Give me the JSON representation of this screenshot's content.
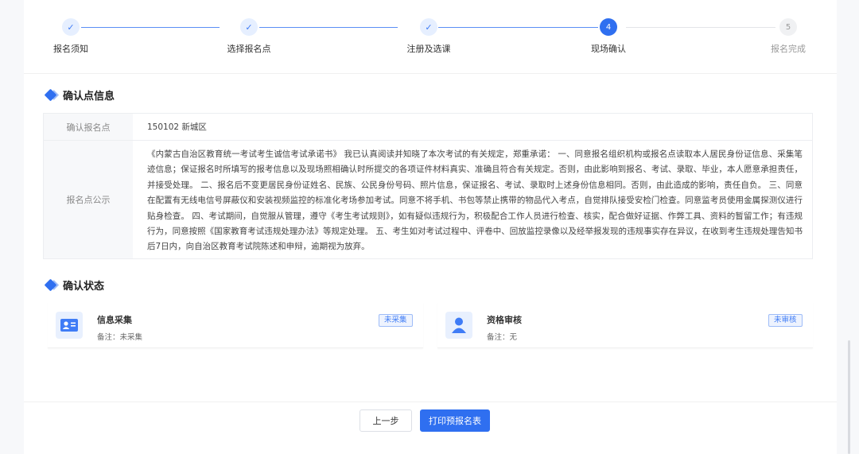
{
  "steps": [
    {
      "label": "报名须知",
      "state": "done",
      "mark": "✓"
    },
    {
      "label": "选择报名点",
      "state": "done",
      "mark": "✓"
    },
    {
      "label": "注册及选课",
      "state": "done",
      "mark": "✓"
    },
    {
      "label": "现场确认",
      "state": "active",
      "mark": "4"
    },
    {
      "label": "报名完成",
      "state": "todo",
      "mark": "5"
    }
  ],
  "confirm_info": {
    "title": "确认点信息",
    "site_label": "确认报名点",
    "site_value": "150102 新城区",
    "notice_label": "报名点公示",
    "notice_text": "《内蒙古自治区教育统一考试考生诚信考试承诺书》 我已认真阅读并知晓了本次考试的有关规定，郑重承诺： 一、同意报名组织机构或报名点读取本人居民身份证信息、采集笔迹信息；保证报名时所填写的报考信息以及现场照相确认时所提交的各项证件材料真实、准确且符合有关规定。否则，由此影响到报名、考试、录取、毕业，本人愿意承担责任，并接受处理。 二、报名后不变更居民身份证姓名、民族、公民身份号码、照片信息，保证报名、考试、录取时上述身份信息相同。否则，由此造成的影响，责任自负。 三、同意在配置有无线电信号屏蔽仪和安装视频监控的标准化考场参加考试。同意不将手机、书包等禁止携带的物品代入考点，自觉排队接受安检门检查。同意监考员使用金属探测仪进行贴身检查。 四、考试期间，自觉服从管理，遵守《考生考试规则》，如有疑似违规行为，积极配合工作人员进行检查、核实，配合做好证据、作弊工具、资料的暂留工作；有违规行为，同意按照《国家教育考试违规处理办法》等规定处理。 五、考生如对考试过程中、评卷中、回放监控录像以及经举报发现的违规事实存在异议，在收到考生违规处理告知书后7日内，向自治区教育考试院陈述和申辩，逾期视为放弃。"
  },
  "confirm_status": {
    "title": "确认状态",
    "cards": [
      {
        "title": "信息采集",
        "note": "备注：未采集",
        "badge": "未采集",
        "icon": "id-card-icon"
      },
      {
        "title": "资格审核",
        "note": "备注：无",
        "badge": "未审核",
        "icon": "user-icon"
      }
    ]
  },
  "buttons": {
    "prev": "上一步",
    "print": "打印预报名表"
  },
  "colors": {
    "primary": "#2f6ff0",
    "light": "#e8f0fe"
  }
}
